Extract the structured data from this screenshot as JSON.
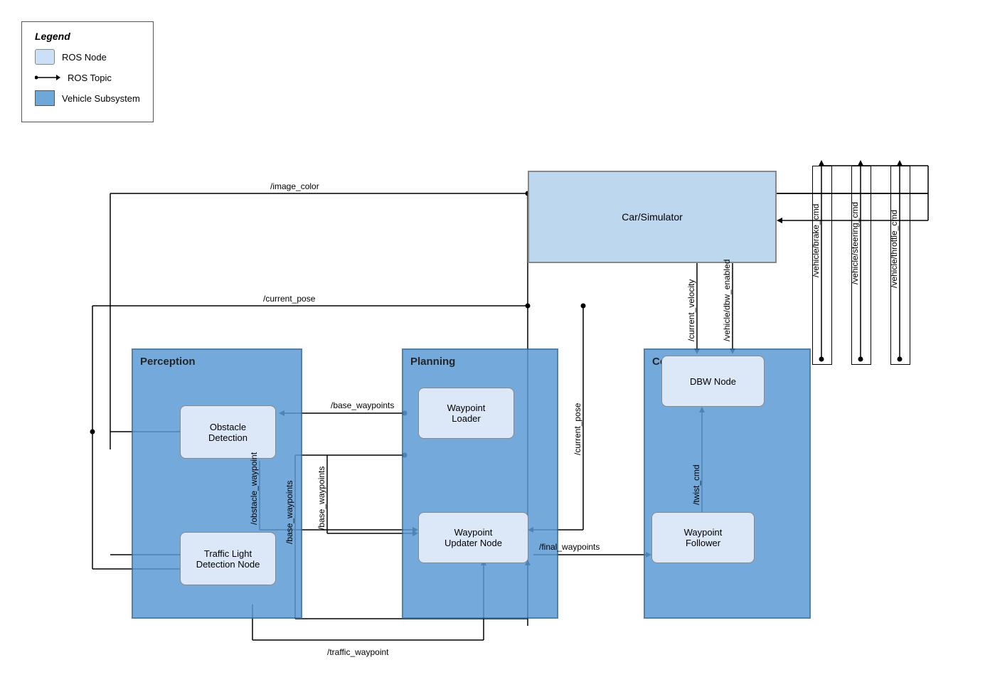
{
  "legend": {
    "title": "Legend",
    "items": [
      {
        "label": "ROS Node",
        "type": "node"
      },
      {
        "label": "ROS Topic",
        "type": "topic"
      },
      {
        "label": "Vehicle Subsystem",
        "type": "vehicle"
      }
    ]
  },
  "diagram": {
    "car_simulator": "Car/Simulator",
    "subsystems": [
      {
        "id": "perception",
        "label": "Perception"
      },
      {
        "id": "planning",
        "label": "Planning"
      },
      {
        "id": "control",
        "label": "Control"
      }
    ],
    "nodes": [
      {
        "id": "obstacle",
        "label": "Obstacle\nDetection"
      },
      {
        "id": "tl_detection",
        "label": "Traffic Light\nDetection Node"
      },
      {
        "id": "waypoint_loader",
        "label": "Waypoint\nLoader"
      },
      {
        "id": "waypoint_updater",
        "label": "Waypoint\nUpdater Node"
      },
      {
        "id": "dbw",
        "label": "DBW Node"
      },
      {
        "id": "waypoint_follower",
        "label": "Waypoint\nFollower"
      }
    ],
    "topics": {
      "image_color": "/image_color",
      "current_pose_top": "/current_pose",
      "current_velocity": "/current_velocity",
      "dbw_enabled": "/vehicle/dbw_enabled",
      "vehicle_brake_cmd": "/vehicle/brake_cmd",
      "vehicle_steering_cmd": "/vehicle/steering_cmd",
      "vehicle_throttle_cmd": "/vehicle/throttle_cmd",
      "base_waypoints_top": "/base_waypoints",
      "obstacle_waypoint": "/obstacle_waypoint",
      "base_waypoints_vert1": "/base_waypoints",
      "base_waypoints_vert2": "/base_waypoints",
      "current_pose_vert": "/current_pose",
      "final_waypoints": "/final_waypoints",
      "twist_cmd": "/twist_cmd",
      "traffic_waypoint": "/traffic_waypoint"
    }
  }
}
